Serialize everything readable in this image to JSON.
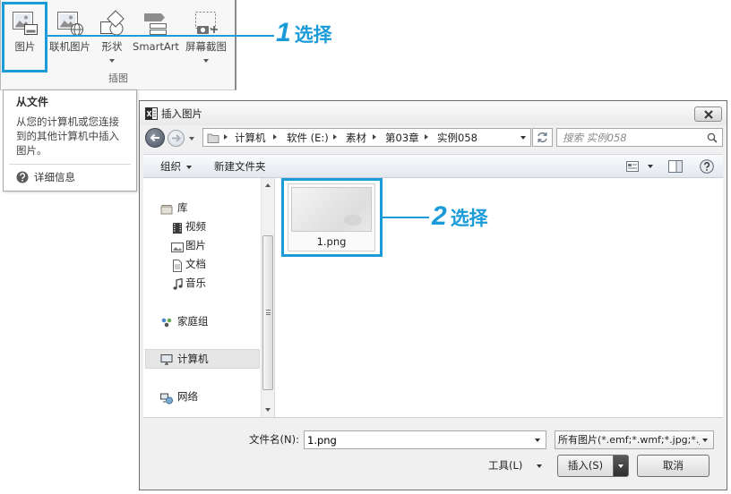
{
  "colors": {
    "accent": "#1b9cd8"
  },
  "ribbon": {
    "buttons": [
      {
        "label": "图片",
        "icon": "picture-icon",
        "selected": true
      },
      {
        "label": "联机图片",
        "icon": "online-picture-icon"
      },
      {
        "label": "形状",
        "icon": "shapes-icon",
        "has_dropdown": true
      },
      {
        "label": "SmartArt",
        "icon": "smartart-icon"
      },
      {
        "label": "屏幕截图",
        "icon": "screenshot-icon",
        "has_dropdown": true
      }
    ],
    "group_label": "插图"
  },
  "tooltip": {
    "title": "从文件",
    "description_lines": [
      "从您的计算机或您连接",
      "到的其他计算机中插入",
      "图片。"
    ],
    "more_info": "详细信息",
    "icon": "help-icon"
  },
  "callouts": [
    {
      "number": "1",
      "text": "选择"
    },
    {
      "number": "2",
      "text": "选择"
    }
  ],
  "dialog": {
    "title": "插入图片",
    "title_icon": "excel-icon",
    "address": {
      "segments": [
        "计算机",
        "软件 (E:)",
        "素材",
        "第03章",
        "实例058"
      ]
    },
    "search": {
      "placeholder": "搜索 实例058"
    },
    "toolbar": {
      "organize_label": "组织",
      "new_folder_label": "新建文件夹"
    },
    "nav": [
      {
        "label": "库",
        "icon": "library-icon"
      },
      {
        "label": "视频",
        "icon": "video-icon"
      },
      {
        "label": "图片",
        "icon": "pictures-icon"
      },
      {
        "label": "文档",
        "icon": "documents-icon"
      },
      {
        "label": "音乐",
        "icon": "music-icon"
      },
      {
        "label": "家庭组",
        "icon": "homegroup-icon"
      },
      {
        "label": "计算机",
        "icon": "computer-icon",
        "selected": true
      },
      {
        "label": "网络",
        "icon": "network-icon"
      }
    ],
    "files": [
      {
        "name": "1.png",
        "selected": true
      }
    ],
    "footer": {
      "filename_label": "文件名(N):",
      "filename_value": "1.png",
      "filter_value": "所有图片(*.emf;*.wmf;*.jpg;*.j",
      "tools_label": "工具(L)",
      "insert_label": "插入(S)",
      "cancel_label": "取消"
    }
  }
}
